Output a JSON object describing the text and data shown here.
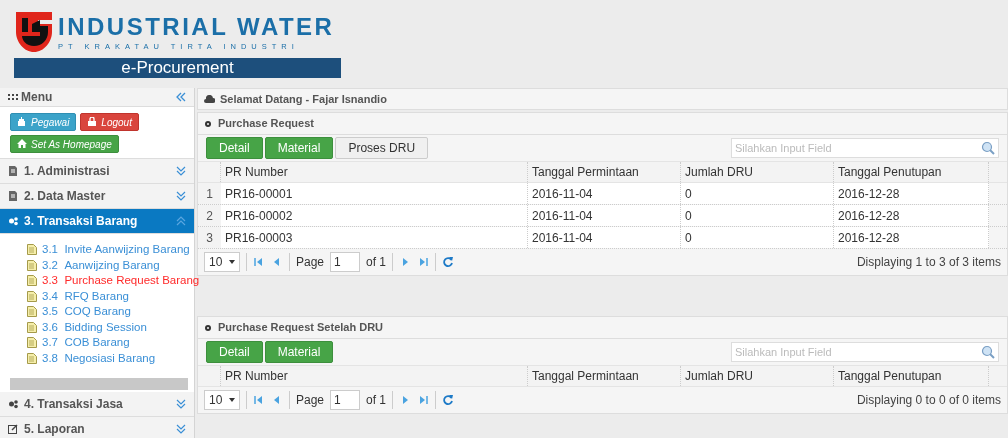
{
  "header": {
    "logo_title": "INDUSTRIAL WATER",
    "logo_subtitle": "PT KRAKATAU TIRTA INDUSTRI",
    "app_name": "e-Procurement"
  },
  "sidebar": {
    "title": "Menu",
    "buttons": [
      {
        "label": "Pegawai",
        "kind": "info"
      },
      {
        "label": "Logout",
        "kind": "danger"
      },
      {
        "label": "Set As Homepage",
        "kind": "success"
      }
    ],
    "sections": [
      {
        "label": "1. Administrasi",
        "selected": false,
        "expanded": false
      },
      {
        "label": "2. Data Master",
        "selected": false,
        "expanded": false
      },
      {
        "label": "3. Transaksi Barang",
        "selected": true,
        "expanded": true,
        "children": [
          {
            "number": "3.1",
            "label": "Invite Aanwijzing Barang",
            "selected": false
          },
          {
            "number": "3.2",
            "label": "Aanwijzing Barang",
            "selected": false
          },
          {
            "number": "3.3",
            "label": "Purchase Request Barang",
            "selected": true
          },
          {
            "number": "3.4",
            "label": "RFQ Barang",
            "selected": false
          },
          {
            "number": "3.5",
            "label": "COQ Barang",
            "selected": false
          },
          {
            "number": "3.6",
            "label": "Bidding Session",
            "selected": false
          },
          {
            "number": "3.7",
            "label": "COB Barang",
            "selected": false
          },
          {
            "number": "3.8",
            "label": "Negosiasi Barang",
            "selected": false
          }
        ]
      },
      {
        "label": "4. Transaksi Jasa",
        "selected": false,
        "expanded": false
      },
      {
        "label": "5. Laporan",
        "selected": false,
        "expanded": false
      }
    ]
  },
  "welcome": "Selamat Datang - Fajar Isnandio",
  "panels": [
    {
      "title": "Purchase Request",
      "buttons": [
        {
          "label": "Detail",
          "kind": "success"
        },
        {
          "label": "Material",
          "kind": "success"
        },
        {
          "label": "Proses DRU",
          "kind": "default"
        }
      ],
      "search": {
        "placeholder": "Silahkan Input Field"
      },
      "columns": [
        "PR Number",
        "Tanggal Permintaan",
        "Jumlah DRU",
        "Tanggal Penutupan"
      ],
      "rows": [
        {
          "number": "1",
          "cells": [
            "PR16-00001",
            "2016-11-04",
            "0",
            "2016-12-28"
          ]
        },
        {
          "number": "2",
          "cells": [
            "PR16-00002",
            "2016-11-04",
            "0",
            "2016-12-28"
          ]
        },
        {
          "number": "3",
          "cells": [
            "PR16-00003",
            "2016-11-04",
            "0",
            "2016-12-28"
          ]
        }
      ],
      "pager": {
        "page_size": "10",
        "page_label": "Page",
        "page": "1",
        "of": "of 1",
        "info": "Displaying 1 to 3 of 3 items"
      }
    },
    {
      "title": "Purchase Request Setelah DRU",
      "buttons": [
        {
          "label": "Detail",
          "kind": "success"
        },
        {
          "label": "Material",
          "kind": "success"
        }
      ],
      "search": {
        "placeholder": "Silahkan Input Field"
      },
      "columns": [
        "PR Number",
        "Tanggal Permintaan",
        "Jumlah DRU",
        "Tanggal Penutupan"
      ],
      "pager": {
        "page_size": "10",
        "page_label": "Page",
        "page": "1",
        "of": "of 1",
        "info": "Displaying 0 to 0 of 0 items"
      }
    }
  ]
}
